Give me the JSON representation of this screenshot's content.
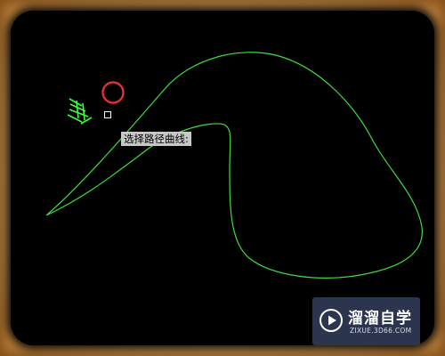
{
  "canvas": {
    "command_prompt": "选择路径曲线:"
  },
  "watermark": {
    "title": "溜溜自学",
    "subtitle": "ZIXUE.3D66.COM",
    "logo_icon": "play-circle-icon"
  },
  "colors": {
    "path_curve": "#3cdc3c",
    "cursor_marker": "#e03030",
    "hatch_marks": "#3cff3c",
    "prompt_bg": "#c8c8c8",
    "watermark_bg": "#343e5c"
  }
}
